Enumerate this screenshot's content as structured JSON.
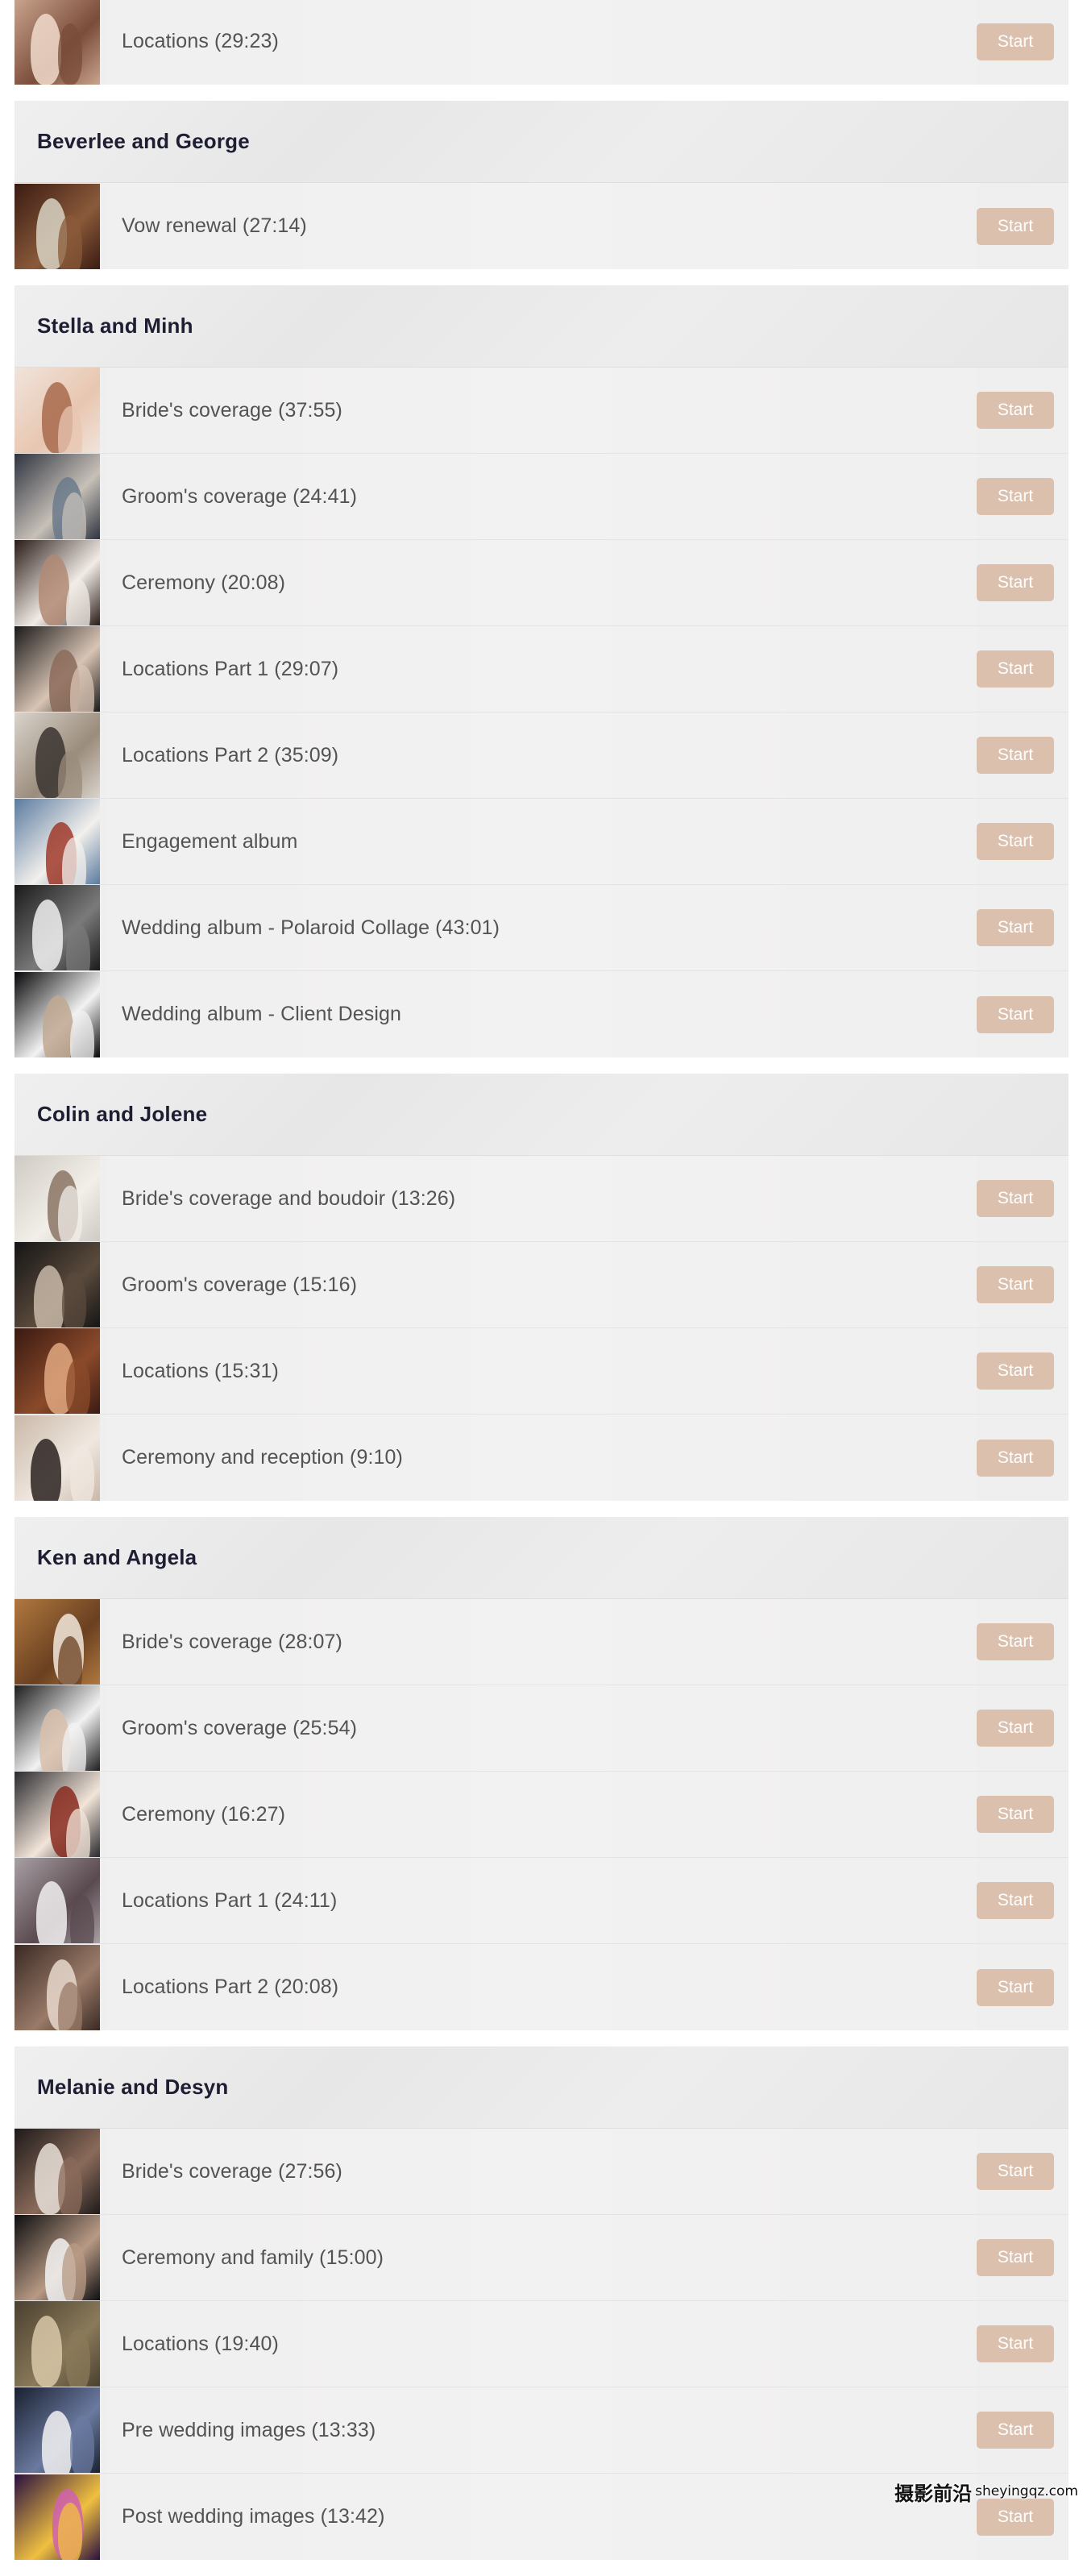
{
  "button_label": "Start",
  "sections": [
    {
      "title": "",
      "partial_top": true,
      "lessons": [
        {
          "title": "Locations (29:23)",
          "thumb": {
            "bg": "#c9a48d",
            "fg": "#f1dccd",
            "accent": "#7a4c3a"
          }
        }
      ]
    },
    {
      "title": "Beverlee and George",
      "lessons": [
        {
          "title": "Vow renewal (27:14)",
          "thumb": {
            "bg": "#3a1b12",
            "fg": "#d8d4c4",
            "accent": "#8a5a3a"
          }
        }
      ]
    },
    {
      "title": "Stella and Minh",
      "lessons": [
        {
          "title": "Bride's coverage (37:55)",
          "thumb": {
            "bg": "#f0e4dc",
            "fg": "#a86a4c",
            "accent": "#e8c6b0"
          }
        },
        {
          "title": "Groom's coverage (24:41)",
          "thumb": {
            "bg": "#2e3440",
            "fg": "#6b7a8c",
            "accent": "#c7c0b8"
          }
        },
        {
          "title": "Ceremony (20:08)",
          "thumb": {
            "bg": "#2a1c18",
            "fg": "#b08a74",
            "accent": "#f2ece6"
          }
        },
        {
          "title": "Locations Part 1 (29:07)",
          "thumb": {
            "bg": "#1b1a1a",
            "fg": "#8c6b5a",
            "accent": "#d8c4b4"
          }
        },
        {
          "title": "Locations Part 2 (35:09)",
          "thumb": {
            "bg": "#d9d4cc",
            "fg": "#3a3430",
            "accent": "#9b8c7c"
          }
        },
        {
          "title": "Engagement album",
          "thumb": {
            "bg": "#5b7ba0",
            "fg": "#a03a2a",
            "accent": "#f2f0ec"
          }
        },
        {
          "title": "Wedding album - Polaroid Collage (43:01)",
          "thumb": {
            "bg": "#1a1a1a",
            "fg": "#efefef",
            "accent": "#7a7a7a"
          }
        },
        {
          "title": "Wedding album - Client Design",
          "thumb": {
            "bg": "#08080a",
            "fg": "#c0a890",
            "accent": "#f2f2f2"
          }
        }
      ]
    },
    {
      "title": "Colin and Jolene",
      "lessons": [
        {
          "title": "Bride's coverage and boudoir (13:26)",
          "thumb": {
            "bg": "#cfcac4",
            "fg": "#8a7464",
            "accent": "#f2eee8"
          }
        },
        {
          "title": "Groom's coverage (15:16)",
          "thumb": {
            "bg": "#151515",
            "fg": "#c8b8a8",
            "accent": "#5a4a3c"
          }
        },
        {
          "title": "Locations (15:31)",
          "thumb": {
            "bg": "#3a1a12",
            "fg": "#e0a880",
            "accent": "#8a4a2a"
          }
        },
        {
          "title": "Ceremony and reception (9:10)",
          "thumb": {
            "bg": "#c9b8a8",
            "fg": "#2a2220",
            "accent": "#f0e8e0"
          }
        }
      ]
    },
    {
      "title": "Ken and Angela",
      "lessons": [
        {
          "title": "Bride's coverage (28:07)",
          "thumb": {
            "bg": "#b07840",
            "fg": "#f2e8dc",
            "accent": "#6a4020"
          }
        },
        {
          "title": "Groom's coverage (25:54)",
          "thumb": {
            "bg": "#1e1e1e",
            "fg": "#d8c0ac",
            "accent": "#f2f2f2"
          }
        },
        {
          "title": "Ceremony (16:27)",
          "thumb": {
            "bg": "#2a2a2e",
            "fg": "#8a2a1e",
            "accent": "#f2e4d8"
          }
        },
        {
          "title": "Locations Part 1 (24:11)",
          "thumb": {
            "bg": "#a8a0a4",
            "fg": "#f2eef0",
            "accent": "#5a4a50"
          }
        },
        {
          "title": "Locations Part 2 (20:08)",
          "thumb": {
            "bg": "#3a2a24",
            "fg": "#e8d8cc",
            "accent": "#9a7a68"
          }
        }
      ]
    },
    {
      "title": "Melanie and Desyn",
      "lessons": [
        {
          "title": "Bride's coverage (27:56)",
          "thumb": {
            "bg": "#1e1a1a",
            "fg": "#e8e0d8",
            "accent": "#8a6a5a"
          }
        },
        {
          "title": "Ceremony and family (15:00)",
          "thumb": {
            "bg": "#0e0e10",
            "fg": "#f2f2f2",
            "accent": "#b89a84"
          }
        },
        {
          "title": "Locations (19:40)",
          "thumb": {
            "bg": "#4a4030",
            "fg": "#d8c8a8",
            "accent": "#8a7a5a"
          }
        },
        {
          "title": "Pre wedding images (13:33)",
          "thumb": {
            "bg": "#1a2030",
            "fg": "#f2f2f2",
            "accent": "#6a7aa0"
          }
        },
        {
          "title": "Post wedding images (13:42)",
          "thumb": {
            "bg": "#2a1040",
            "fg": "#d060b0",
            "accent": "#f0c040"
          }
        }
      ]
    }
  ],
  "watermark": {
    "main": "摄影前沿",
    "small": "sheyingqz.com"
  }
}
